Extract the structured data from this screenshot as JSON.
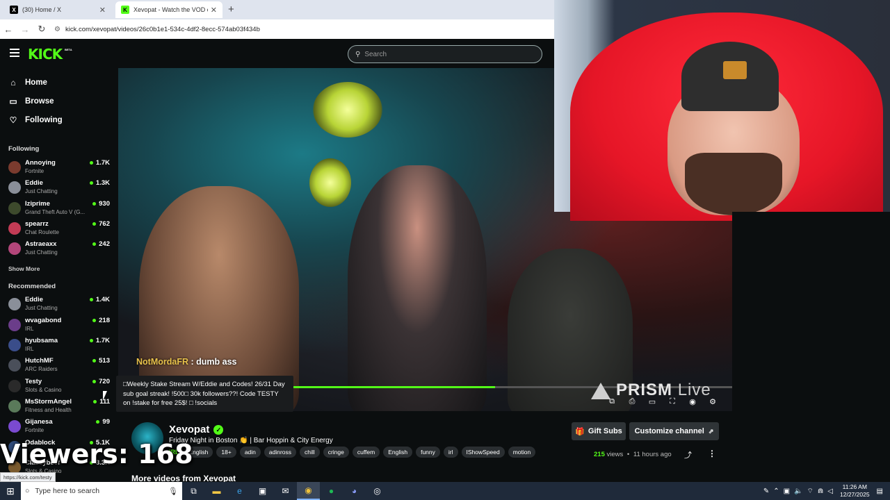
{
  "browser": {
    "tabs": [
      {
        "title": "(30) Home / X",
        "favicon": "x-logo"
      },
      {
        "title": "Xevopat - Watch the VOD on Kick",
        "favicon": "kick-logo"
      }
    ],
    "url": "kick.com/xevopat/videos/26c0b1e1-534c-4df2-8ecc-574ab03f434b"
  },
  "kick": {
    "logo": "KICK",
    "beta": "BETA",
    "search_placeholder": "Search"
  },
  "sidebar": {
    "nav": [
      {
        "label": "Home",
        "icon": "home-icon"
      },
      {
        "label": "Browse",
        "icon": "browse-icon"
      },
      {
        "label": "Following",
        "icon": "heart-icon"
      }
    ],
    "following_title": "Following",
    "following": [
      {
        "name": "Annoying",
        "category": "Fortnite",
        "viewers": "1.7K",
        "color": "#7a3b2e"
      },
      {
        "name": "Eddie",
        "category": "Just Chatting",
        "viewers": "1.3K",
        "color": "#8a8f99"
      },
      {
        "name": "Iziprime",
        "category": "Grand Theft Auto V (G...",
        "viewers": "930",
        "color": "#3d4a2c"
      },
      {
        "name": "spearrz",
        "category": "Chat Roulette",
        "viewers": "762",
        "color": "#c23b55"
      },
      {
        "name": "Astraeaxx",
        "category": "Just Chatting",
        "viewers": "242",
        "color": "#b3467a"
      }
    ],
    "show_more": "Show More",
    "recommended_title": "Recommended",
    "recommended": [
      {
        "name": "Eddie",
        "category": "Just Chatting",
        "viewers": "1.4K",
        "color": "#8a8f99"
      },
      {
        "name": "wvagabond",
        "category": "IRL",
        "viewers": "218",
        "color": "#6b3d8a"
      },
      {
        "name": "hyubsama",
        "category": "IRL",
        "viewers": "1.7K",
        "color": "#3a4d8a"
      },
      {
        "name": "HutchMF",
        "category": "ARC Raiders",
        "viewers": "513",
        "color": "#4a4f5a"
      },
      {
        "name": "Testy",
        "category": "Slots & Casino",
        "viewers": "720",
        "color": "#2a2a2a"
      },
      {
        "name": "MsStormAngel",
        "category": "Fitness and Health",
        "viewers": "111",
        "color": "#5a7a5a"
      },
      {
        "name": "Gijanesa",
        "category": "Fortnite",
        "viewers": "99",
        "color": "#7a4ad0"
      },
      {
        "name": "Odablock",
        "category": "",
        "viewers": "5.1K",
        "color": "#2e4a7a"
      },
      {
        "name": "Classybeef",
        "category": "Slots & Casino",
        "viewers": "3.3K",
        "color": "#7a5a2e"
      }
    ]
  },
  "player": {
    "chat_user": "NotMordaFR",
    "chat_text": ": dumb ass",
    "progress": 0.46,
    "watermark": "PRISM",
    "watermark_live": "Live"
  },
  "tooltip": "□Weekly Stake Stream W/Eddie and Codes! 26/31 Day sub goal streak! !500□ 30k followers??! Code TESTY on !stake for free 25$! □ !socials",
  "channel": {
    "name": "Xevopat",
    "title": "Friday Night in Boston 👏 | Bar Hoppin & City Energy",
    "lang_short": "IRL",
    "tags": [
      "English",
      "18+",
      "adin",
      "adinross",
      "chill",
      "cringe",
      "cuffem",
      "English",
      "funny",
      "irl",
      "IShowSpeed",
      "motion"
    ],
    "gift_subs": "Gift Subs",
    "customize": "Customize channel",
    "views": "215",
    "views_label": "views",
    "age": "11 hours ago",
    "more_videos": "More videos from Xevopat"
  },
  "overlay": {
    "viewers": "Viewers: 168"
  },
  "status_url": "https://kick.com/testy",
  "taskbar": {
    "search_placeholder": "Type here to search",
    "time": "11:26 AM",
    "date": "12/27/2025"
  }
}
